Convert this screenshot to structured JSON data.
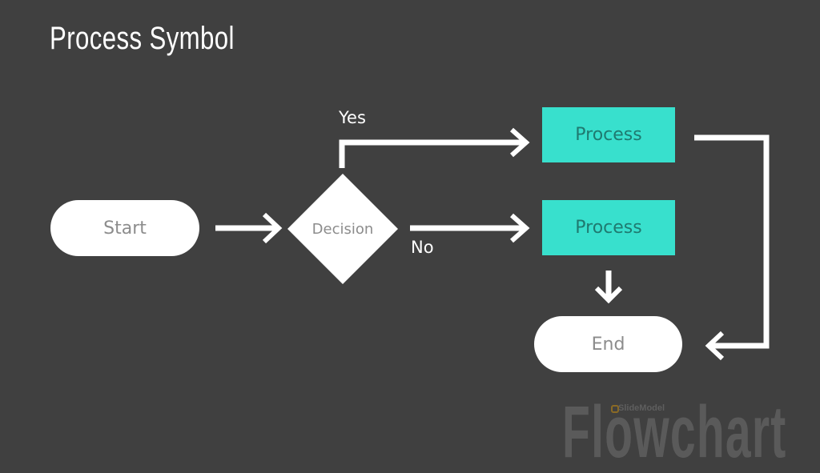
{
  "slide": {
    "title": "Process Symbol",
    "watermark": "Flowchart",
    "brand": "SlideModel",
    "colors": {
      "background": "#404040",
      "process_fill": "#38e0cd",
      "process_text": "#1f7a70",
      "terminal_fill": "#ffffff",
      "terminal_text": "#8c8c8c",
      "connector": "#ffffff"
    }
  },
  "nodes": {
    "start": "Start",
    "decision": "Decision",
    "process_yes": "Process",
    "process_no": "Process",
    "end": "End"
  },
  "edges": {
    "yes_label": "Yes",
    "no_label": "No"
  }
}
